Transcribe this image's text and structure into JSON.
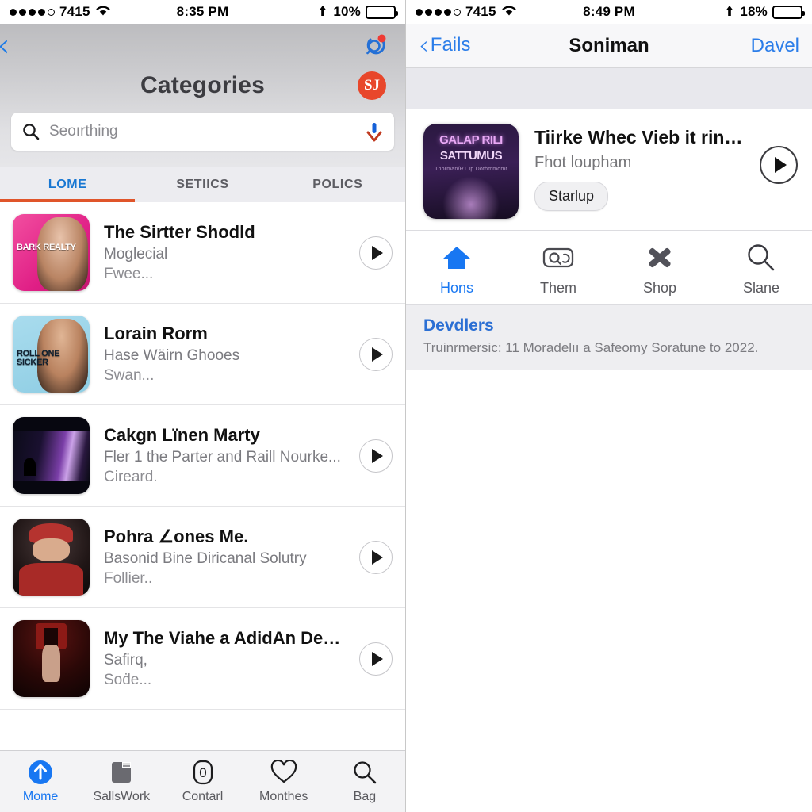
{
  "left": {
    "status": {
      "carrier": "7415",
      "signal_dots": 5,
      "signal_filled": 4,
      "wifi_icon": "wifi-icon",
      "time": "8:35 PM",
      "location_icon": "location-arrow-icon",
      "battery_percent": "10%",
      "battery_level": 10
    },
    "nav": {
      "back_icon": "back-chevron-icon",
      "search_icon": "search-refresh-icon",
      "badge_dot": "notification-dot"
    },
    "title": "Categories",
    "profile_badge": "SJ",
    "profile_badge_color": "#e8472b",
    "search": {
      "icon": "search-icon",
      "placeholder": "Seoırthing",
      "value": "",
      "mic_icon": "download-arrow-icon"
    },
    "tabs": [
      {
        "label": "LOME",
        "active": true
      },
      {
        "label": "SETIICS",
        "active": false
      },
      {
        "label": "POLICS",
        "active": false
      }
    ],
    "tab_accent": "#e0552a",
    "tab_active_color": "#1877d2",
    "items": [
      {
        "title": "The Sirtter Shodld",
        "sub1": "Moglecial",
        "sub2": "Fwee...",
        "art_label": "BARK REALTY",
        "art_bg": "#e8358f",
        "art_face": "#c9a18a",
        "play_icon": "play-icon"
      },
      {
        "title": "Lorain Rorm",
        "sub1": "Hase Wäirn Ghooes",
        "sub2": "Swan...",
        "art_label": "ROLL ONE SICKER",
        "art_bg": "#9fd4e8",
        "art_face": "#d4a98d",
        "play_icon": "play-icon"
      },
      {
        "title": "Cakgn Lïnen Marty",
        "sub1": "Fler 1 the Parter and Raill Nourke...",
        "sub2": "Cireard.",
        "art_label": "",
        "art_bg": "#0a0a10",
        "art_face": "#6b3f8e",
        "play_icon": "play-icon"
      },
      {
        "title": "Pohra ∠ones Me.",
        "sub1": "Basonid Bine Diricanal Solutry",
        "sub2": "Follier..",
        "art_label": "",
        "art_bg": "#2a1d1d",
        "art_face": "#b5332f",
        "play_icon": "play-icon"
      },
      {
        "title": "My The Viahe a AdidAn Dene ...",
        "sub1": "Safirq,",
        "sub2": "Soḋe...",
        "art_label": "",
        "art_bg": "#150505",
        "art_face": "#8c1a16",
        "play_icon": "play-icon"
      }
    ],
    "tabbar": [
      {
        "label": "Mome",
        "icon": "home-up-arrow-icon",
        "active": true
      },
      {
        "label": "SallsWork",
        "icon": "book-icon",
        "active": false
      },
      {
        "label": "Contarl",
        "icon": "zero-badge-icon",
        "active": false
      },
      {
        "label": "Monthes",
        "icon": "heart-icon",
        "active": false
      },
      {
        "label": "Bag",
        "icon": "search-icon",
        "active": false
      }
    ]
  },
  "right": {
    "status": {
      "carrier": "7415",
      "signal_dots": 5,
      "signal_filled": 4,
      "wifi_icon": "wifi-icon",
      "time": "8:49 PM",
      "location_icon": "location-arrow-icon",
      "battery_percent": "18%",
      "battery_level": 18
    },
    "nav": {
      "back_icon": "back-chevron-icon",
      "back_label": "Fails",
      "title": "Soniman",
      "action_label": "Davel"
    },
    "card": {
      "art_line1": "GALAP RILI",
      "art_line2": "SATTUMUS",
      "art_line3": "Thorman/RT  ıp  Dothmmomr",
      "title": "Tiirke Whec Vieb it ringson...",
      "subtitle": "Fhot loupham",
      "pill_label": "Starlup",
      "play_icon": "play-icon"
    },
    "icons": [
      {
        "label": "Hons",
        "icon": "home-icon",
        "active": true
      },
      {
        "label": "Them",
        "icon": "search-box-icon",
        "active": false
      },
      {
        "label": "Shop",
        "icon": "crossed-bandages-icon",
        "active": false
      },
      {
        "label": "Slane",
        "icon": "magnifier-icon",
        "active": false
      }
    ],
    "footer": {
      "link": "Devdlers",
      "note": "Truinrmersic: 11 Moradelıı a Safeomy Soratune to 2022."
    }
  }
}
